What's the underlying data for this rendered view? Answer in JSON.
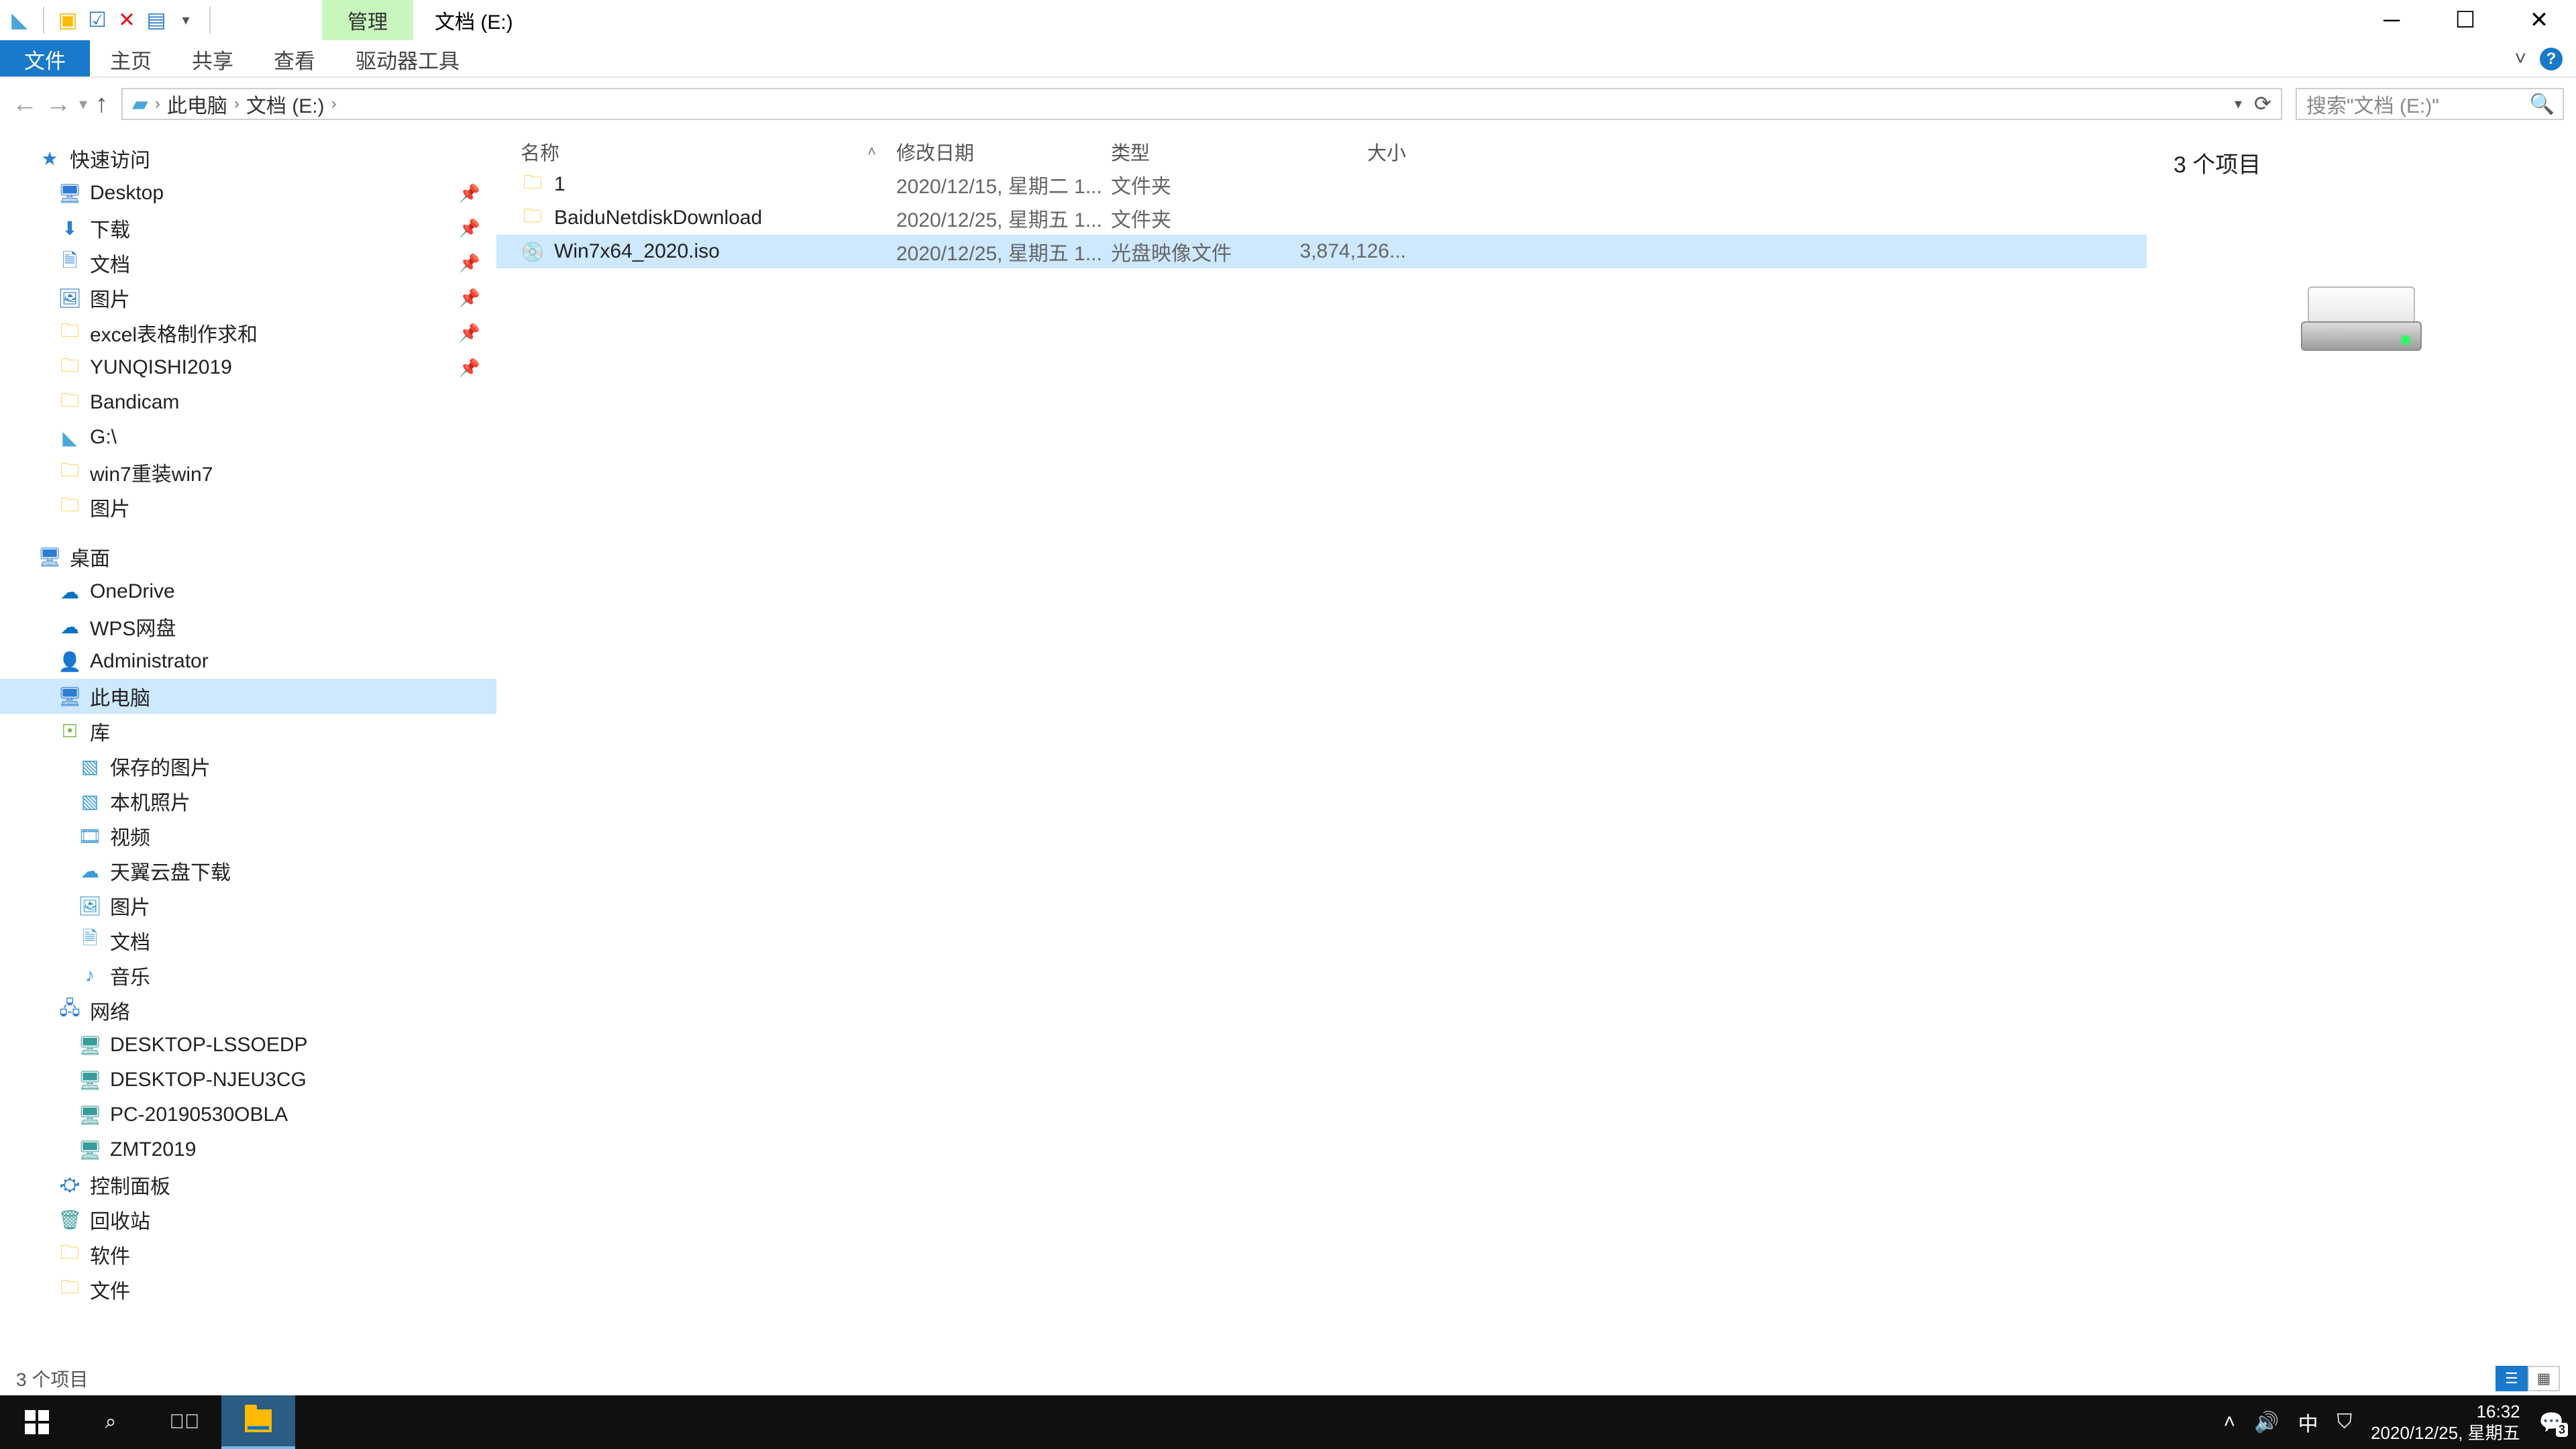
{
  "title": {
    "contextual_tab": "管理",
    "window_title": "文档 (E:)"
  },
  "ribbon": {
    "file": "文件",
    "home": "主页",
    "share": "共享",
    "view": "查看",
    "drive_tools": "驱动器工具"
  },
  "address": {
    "crumb1": "此电脑",
    "crumb2": "文档 (E:)"
  },
  "search": {
    "placeholder": "搜索\"文档 (E:)\""
  },
  "sidebar": {
    "quick_access": "快速访问",
    "quick": [
      {
        "label": "Desktop"
      },
      {
        "label": "下载"
      },
      {
        "label": "文档"
      },
      {
        "label": "图片"
      },
      {
        "label": "excel表格制作求和"
      },
      {
        "label": "YUNQISHI2019"
      },
      {
        "label": "Bandicam"
      },
      {
        "label": "G:\\"
      },
      {
        "label": "win7重装win7"
      },
      {
        "label": "图片"
      }
    ],
    "desktop": "桌面",
    "desktop_items": [
      {
        "label": "OneDrive",
        "icon": "cloud"
      },
      {
        "label": "WPS网盘",
        "icon": "wps"
      },
      {
        "label": "Administrator",
        "icon": "user"
      },
      {
        "label": "此电脑",
        "icon": "pc",
        "selected": true
      },
      {
        "label": "库",
        "icon": "lib"
      }
    ],
    "libs": [
      {
        "label": "保存的图片"
      },
      {
        "label": "本机照片"
      },
      {
        "label": "视频"
      },
      {
        "label": "天翼云盘下载"
      },
      {
        "label": "图片"
      },
      {
        "label": "文档"
      },
      {
        "label": "音乐"
      }
    ],
    "network": "网络",
    "network_items": [
      {
        "label": "DESKTOP-LSSOEDP"
      },
      {
        "label": "DESKTOP-NJEU3CG"
      },
      {
        "label": "PC-20190530OBLA"
      },
      {
        "label": "ZMT2019"
      }
    ],
    "control_panel": "控制面板",
    "recycle": "回收站",
    "software": "软件",
    "docs": "文件"
  },
  "columns": {
    "name": "名称",
    "date": "修改日期",
    "type": "类型",
    "size": "大小"
  },
  "files": [
    {
      "name": "1",
      "date": "2020/12/15, 星期二 1...",
      "type": "文件夹",
      "size": "",
      "icon": "folder"
    },
    {
      "name": "BaiduNetdiskDownload",
      "date": "2020/12/25, 星期五 1...",
      "type": "文件夹",
      "size": "",
      "icon": "folder"
    },
    {
      "name": "Win7x64_2020.iso",
      "date": "2020/12/25, 星期五 1...",
      "type": "光盘映像文件",
      "size": "3,874,126...",
      "icon": "iso",
      "selected": true
    }
  ],
  "preview": {
    "title": "3 个项目"
  },
  "statusbar": {
    "items": "3 个项目"
  },
  "taskbar": {
    "time": "16:32",
    "date": "2020/12/25, 星期五",
    "ime": "中"
  }
}
